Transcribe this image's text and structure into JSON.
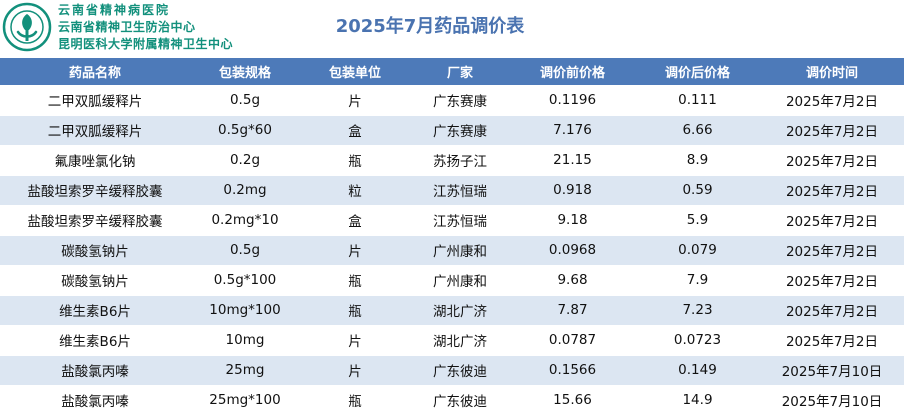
{
  "header": {
    "hospital_names": [
      "云南省精神病医院",
      "云南省精神卫生防治中心",
      "昆明医科大学附属精神卫生中心"
    ],
    "title": "2025年7月药品调价表"
  },
  "colors": {
    "brand_green": "#12907c",
    "title_blue": "#4a73b0",
    "header_bg": "#4d7ab9",
    "stripe_bg": "#dce6f2"
  },
  "table": {
    "columns": [
      "药品名称",
      "包装规格",
      "包装单位",
      "厂家",
      "调价前价格",
      "调价后价格",
      "调价时间"
    ],
    "rows": [
      [
        "二甲双胍缓释片",
        "0.5g",
        "片",
        "广东赛康",
        "0.1196",
        "0.111",
        "2025年7月2日"
      ],
      [
        "二甲双胍缓释片",
        "0.5g*60",
        "盒",
        "广东赛康",
        "7.176",
        "6.66",
        "2025年7月2日"
      ],
      [
        "氟康唑氯化钠",
        "0.2g",
        "瓶",
        "苏扬子江",
        "21.15",
        "8.9",
        "2025年7月2日"
      ],
      [
        "盐酸坦索罗辛缓释胶囊",
        "0.2mg",
        "粒",
        "江苏恒瑞",
        "0.918",
        "0.59",
        "2025年7月2日"
      ],
      [
        "盐酸坦索罗辛缓释胶囊",
        "0.2mg*10",
        "盒",
        "江苏恒瑞",
        "9.18",
        "5.9",
        "2025年7月2日"
      ],
      [
        "碳酸氢钠片",
        "0.5g",
        "片",
        "广州康和",
        "0.0968",
        "0.079",
        "2025年7月2日"
      ],
      [
        "碳酸氢钠片",
        "0.5g*100",
        "瓶",
        "广州康和",
        "9.68",
        "7.9",
        "2025年7月2日"
      ],
      [
        "维生素B6片",
        "10mg*100",
        "瓶",
        "湖北广济",
        "7.87",
        "7.23",
        "2025年7月2日"
      ],
      [
        "维生素B6片",
        "10mg",
        "片",
        "湖北广济",
        "0.0787",
        "0.0723",
        "2025年7月2日"
      ],
      [
        "盐酸氯丙嗪",
        "25mg",
        "片",
        "广东彼迪",
        "0.1566",
        "0.149",
        "2025年7月10日"
      ],
      [
        "盐酸氯丙嗪",
        "25mg*100",
        "瓶",
        "广东彼迪",
        "15.66",
        "14.9",
        "2025年7月10日"
      ]
    ]
  }
}
